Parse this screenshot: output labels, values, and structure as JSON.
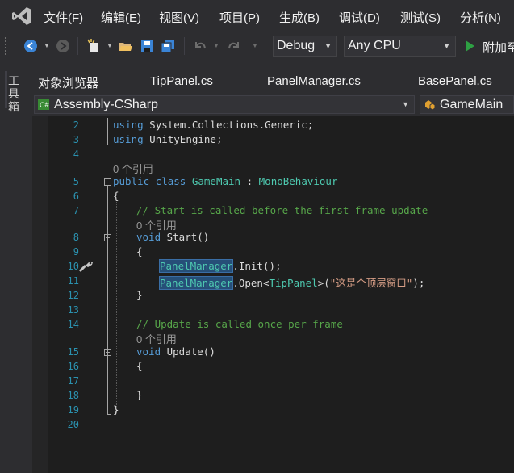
{
  "menu": {
    "items": [
      "文件(F)",
      "编辑(E)",
      "视图(V)",
      "项目(P)",
      "生成(B)",
      "调试(D)",
      "测试(S)",
      "分析(N)"
    ]
  },
  "toolbar": {
    "config": "Debug",
    "platform": "Any CPU",
    "attach": "附加至"
  },
  "toolbox": {
    "label": "工具箱"
  },
  "tabs": [
    "对象浏览器",
    "TipPanel.cs",
    "PanelManager.cs",
    "BasePanel.cs"
  ],
  "navbar": {
    "project": "Assembly-CSharp",
    "type": "GameMain"
  },
  "editor": {
    "line_numbers": [
      "2",
      "3",
      "4",
      "5",
      "6",
      "7",
      "8",
      "9",
      "10",
      "11",
      "12",
      "13",
      "14",
      "15",
      "16",
      "17",
      "18",
      "19",
      "20"
    ],
    "refs": "0 个引用",
    "code": {
      "l2_using": "using",
      "l2_ns": " System.Collections.Generic;",
      "l3_using": "using",
      "l3_ns": " UnityEngine;",
      "l5_public": "public",
      "l5_class": " class ",
      "l5_name": "GameMain",
      "l5_colon": " : ",
      "l5_base": "MonoBehaviour",
      "l6": "{",
      "l7_comment": "// Start is called before the first frame update",
      "l8_void": "void",
      "l8_name": " Start()",
      "l9": "{",
      "l10_type": "PanelManager",
      "l10_rest": ".Init();",
      "l11_type": "PanelManager",
      "l11_a": ".Open<",
      "l11_generic": "TipPanel",
      "l11_b": ">(",
      "l11_str": "\"这是个顶层窗口\"",
      "l11_c": ");",
      "l12": "}",
      "l14_comment": "// Update is called once per frame",
      "l15_void": "void",
      "l15_name": " Update()",
      "l16": "{",
      "l18": "}",
      "l19": "}"
    }
  },
  "colors": {
    "background": "#2d2d30",
    "editor": "#1e1e1e",
    "keyword": "#569cd6",
    "type": "#4ec9b0",
    "comment": "#57a64a",
    "string": "#d69d85",
    "line_number": "#2b91af"
  }
}
